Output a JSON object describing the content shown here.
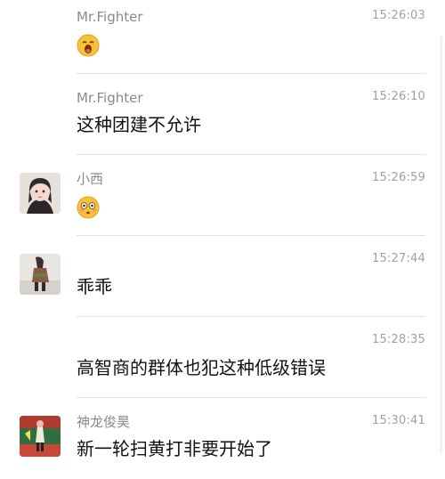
{
  "messages": [
    {
      "sender": "Mr.Fighter",
      "time": "15:26:03",
      "emoji": "yawning-face-emoji"
    },
    {
      "sender": "Mr.Fighter",
      "time": "15:26:10",
      "text": "这种团建不允许"
    },
    {
      "sender": "小西",
      "time": "15:26:59",
      "emoji": "flushed-face-emoji"
    },
    {
      "sender": "",
      "time": "15:27:44",
      "text": "乖乖"
    },
    {
      "sender": "",
      "time": "15:28:35",
      "text": "高智商的群体也犯这种低级错误"
    },
    {
      "sender": "神龙俊昊",
      "time": "15:30:41",
      "text": "新一轮扫黄打非要开始了"
    }
  ]
}
